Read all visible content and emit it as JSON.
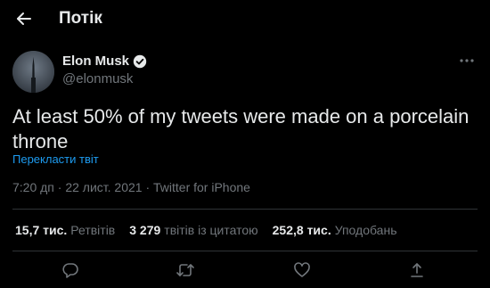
{
  "header": {
    "title": "Потік",
    "back_icon": "arrow-left-icon"
  },
  "author": {
    "name": "Elon Musk",
    "handle": "@elonmusk",
    "verified": true,
    "verified_icon": "verified-badge-icon",
    "more_icon": "more-horizontal-icon"
  },
  "tweet": {
    "text": "At least 50% of my tweets were made on a porcelain throne",
    "translate_label": "Перекласти твіт",
    "meta": "7:20 дп · 22 лист. 2021 · Twitter for iPhone"
  },
  "stats": {
    "retweets_value": "15,7 тис.",
    "retweets_label": "Ретвітів",
    "quotes_value": "3 279",
    "quotes_label": "твітів із цитатою",
    "likes_value": "252,8 тис.",
    "likes_label": "Уподобань"
  },
  "actions": {
    "reply_icon": "reply-icon",
    "retweet_icon": "retweet-icon",
    "like_icon": "heart-icon",
    "share_icon": "share-icon"
  },
  "colors": {
    "background": "#000000",
    "text_primary": "#e7e9ea",
    "text_secondary": "#71767b",
    "accent": "#1d9bf0",
    "divider": "#2f3336"
  }
}
